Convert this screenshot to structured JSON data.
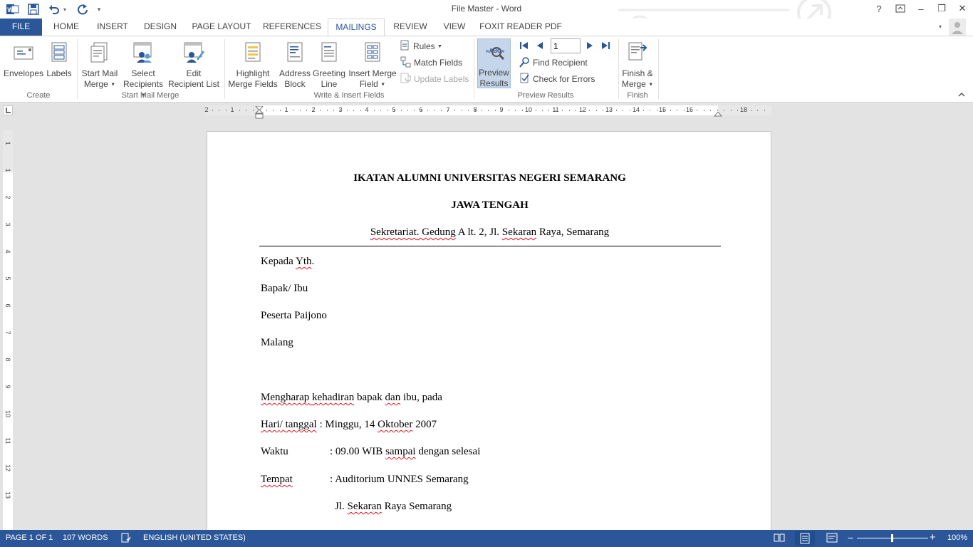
{
  "window": {
    "title": "File Master - Word",
    "help": "?",
    "restore_ribbon": "⧉",
    "minimize": "–",
    "maximize": "❐",
    "close": "✕"
  },
  "qat": {
    "word_icon": "W",
    "save_icon": "save-icon",
    "undo_icon": "undo-icon",
    "redo_icon": "redo-icon",
    "customize": "▾"
  },
  "tabs": [
    {
      "label": "FILE"
    },
    {
      "label": "HOME"
    },
    {
      "label": "INSERT"
    },
    {
      "label": "DESIGN"
    },
    {
      "label": "PAGE LAYOUT"
    },
    {
      "label": "REFERENCES"
    },
    {
      "label": "MAILINGS"
    },
    {
      "label": "REVIEW"
    },
    {
      "label": "VIEW"
    },
    {
      "label": "FOXIT READER PDF"
    }
  ],
  "ribbon": {
    "create": {
      "label": "Create",
      "envelopes": "Envelopes",
      "labels": "Labels"
    },
    "start_mail_merge": {
      "label": "Start Mail Merge",
      "start_line1": "Start Mail",
      "start_line2": "Merge",
      "select_line1": "Select",
      "select_line2": "Recipients",
      "edit_line1": "Edit",
      "edit_line2": "Recipient List"
    },
    "write_insert": {
      "label": "Write & Insert Fields",
      "highlight_line1": "Highlight",
      "highlight_line2": "Merge Fields",
      "address_line1": "Address",
      "address_line2": "Block",
      "greeting_line1": "Greeting",
      "greeting_line2": "Line",
      "insert_line1": "Insert Merge",
      "insert_line2": "Field",
      "rules": "Rules",
      "match_fields": "Match Fields",
      "update_labels": "Update Labels"
    },
    "preview": {
      "label": "Preview Results",
      "preview_line1": "Preview",
      "preview_line2": "Results",
      "record_value": "1",
      "find_recipient": "Find Recipient",
      "check_errors": "Check for Errors"
    },
    "finish": {
      "label": "Finish",
      "finish_line1": "Finish &",
      "finish_line2": "Merge"
    }
  },
  "ruler": {
    "h_labels": [
      "2",
      "1",
      "1",
      "2",
      "3",
      "4",
      "5",
      "6",
      "7",
      "8",
      "9",
      "10",
      "11",
      "12",
      "13",
      "14",
      "15",
      "16",
      "18"
    ],
    "v_labels": [
      "1",
      "1",
      "2",
      "3",
      "4",
      "5",
      "6",
      "7",
      "8",
      "9",
      "10",
      "11",
      "12",
      "13"
    ]
  },
  "document": {
    "heading1": "IKATAN ALUMNI UNIVERSITAS NEGERI SEMARANG",
    "heading2": "JAWA TENGAH",
    "address": {
      "w1": "Sekretariat",
      "w2": ". ",
      "w3": "Gedung",
      "w4": " A lt. 2, Jl. ",
      "w5": "Sekaran",
      "w6": " Raya, Semarang"
    },
    "kepada": {
      "w1": "Kepada ",
      "w2": "Yth",
      "w3": "."
    },
    "bapak": "Bapak/ Ibu",
    "peserta": "Peserta Paijono",
    "kota": "Malang",
    "mengharap": {
      "w1": "Mengharap",
      "w2": " ",
      "w3": "kehadiran",
      "w4": " bapak ",
      "w5": "dan",
      "w6": " ibu, pada"
    },
    "hari": {
      "w1": "Hari",
      "w2": "/ ",
      "w3": "tanggal",
      "w4": "   : Minggu, 14 ",
      "w5": "Oktober",
      "w6": " 2007"
    },
    "waktu": {
      "label": "Waktu",
      "w1": ": 09.00 WIB ",
      "w2": "sampai",
      "w3": " dengan selesai"
    },
    "tempat": {
      "label": "Tempat",
      "value": ": Auditorium UNNES Semarang"
    },
    "alamat": {
      "w1": "Jl. ",
      "w2": "Sekaran",
      "w3": " Raya Semarang"
    }
  },
  "statusbar": {
    "page": "PAGE 1 OF 1",
    "words": "107 WORDS",
    "language": "ENGLISH (UNITED STATES)",
    "zoom": "100%",
    "zoom_minus": "−",
    "zoom_plus": "+"
  },
  "colors": {
    "accent": "#2b579a",
    "spell_error": "#e81123"
  }
}
